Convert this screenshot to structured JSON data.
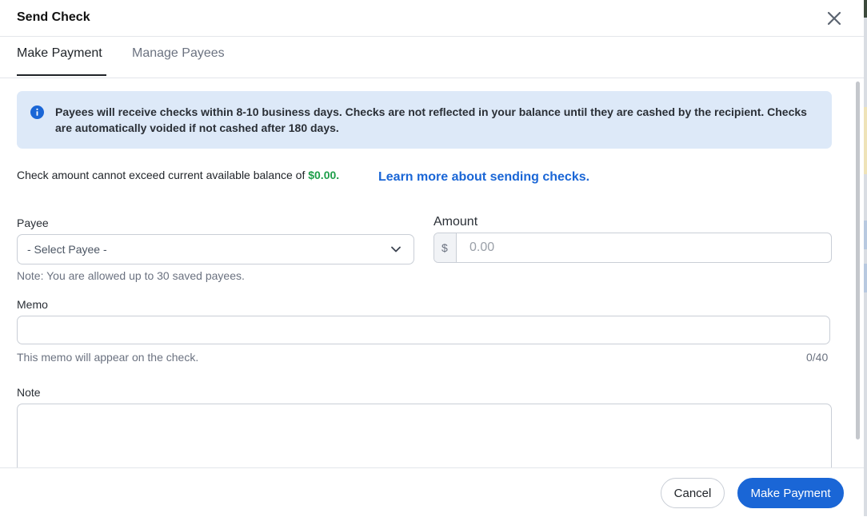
{
  "dialog": {
    "title": "Send Check"
  },
  "tabs": [
    {
      "label": "Make Payment",
      "active": true
    },
    {
      "label": "Manage Payees",
      "active": false
    }
  ],
  "info": {
    "text": "Payees will receive checks within 8-10 business days. Checks are not reflected in your balance until they are cashed by the recipient. Checks are automatically voided if not cashed after 180 days."
  },
  "balance": {
    "prefix": "Check amount cannot exceed current available balance of",
    "amount": "$0.00.",
    "link": "Learn more about sending checks."
  },
  "form": {
    "payee": {
      "label": "Payee",
      "selected": "- Select Payee -",
      "note": "Note: You are allowed up to 30 saved payees."
    },
    "amount": {
      "label": "Amount",
      "currency": "$",
      "placeholder": "0.00"
    },
    "memo": {
      "label": "Memo",
      "value": "",
      "hint": "This memo will appear on the check.",
      "counter": "0/40"
    },
    "note": {
      "label": "Note",
      "value": ""
    }
  },
  "footer": {
    "cancel_label": "Cancel",
    "submit_label": "Make Payment"
  },
  "colors": {
    "primary": "#1a66d6",
    "info_bg": "#dde9f8",
    "balance_green": "#1e9e4a"
  }
}
